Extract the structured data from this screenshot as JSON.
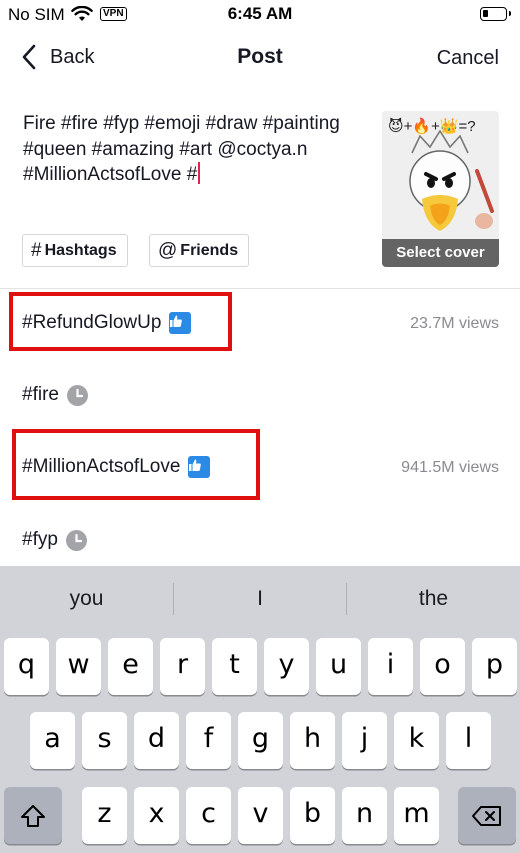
{
  "status_bar": {
    "carrier": "No SIM",
    "vpn": "VPN",
    "time": "6:45 AM",
    "battery_level": 0.15
  },
  "nav": {
    "back_label": "Back",
    "title": "Post",
    "cancel_label": "Cancel"
  },
  "caption": {
    "text": "Fire #fire #fyp #emoji #draw #painting #queen #amazing #art @coctya.n #MillionActsofLove #"
  },
  "cover": {
    "emoji_formula": "😈+🔥+👑=?",
    "label": "Select cover"
  },
  "chips": {
    "hashtags": "Hashtags",
    "hashtags_symbol": "#",
    "friends": "Friends",
    "friends_symbol": "@"
  },
  "suggestions": [
    {
      "tag": "#RefundGlowUp",
      "icon": "thumbs-up-icon",
      "views": "23.7M views",
      "highlighted": true
    },
    {
      "tag": "#fire",
      "icon": "clock-icon",
      "views": "",
      "highlighted": false
    },
    {
      "tag": "#MillionActsofLove",
      "icon": "thumbs-up-icon",
      "views": "941.5M views",
      "highlighted": true
    },
    {
      "tag": "#fyp",
      "icon": "clock-icon",
      "views": "",
      "highlighted": false
    }
  ],
  "colors": {
    "highlight": "#e01010",
    "thumb": "#2a8ae6",
    "caret": "#e2244b",
    "keyboard_bg": "#d1d3d9"
  },
  "keyboard": {
    "predictions": [
      "you",
      "I",
      "the"
    ],
    "row1": [
      "q",
      "w",
      "e",
      "r",
      "t",
      "y",
      "u",
      "i",
      "o",
      "p"
    ],
    "row2": [
      "a",
      "s",
      "d",
      "f",
      "g",
      "h",
      "j",
      "k",
      "l"
    ],
    "row3": [
      "z",
      "x",
      "c",
      "v",
      "b",
      "n",
      "m"
    ],
    "shift_icon": "shift-icon",
    "delete_icon": "backspace-icon"
  }
}
